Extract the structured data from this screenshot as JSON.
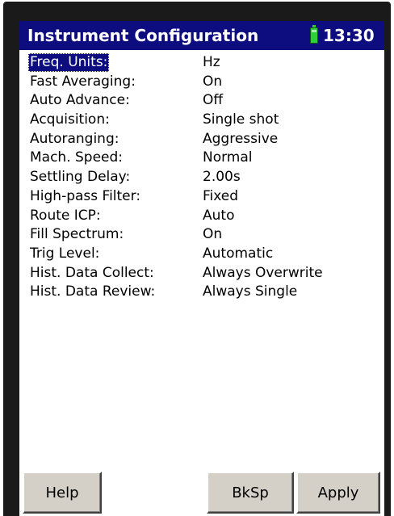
{
  "titlebar": {
    "title": "Instrument Configuration",
    "battery_icon": "battery-icon",
    "time": "13:30"
  },
  "settings": [
    {
      "label": "Freq. Units:",
      "value": "Hz",
      "selected": true
    },
    {
      "label": "Fast Averaging:",
      "value": "On"
    },
    {
      "label": "Auto Advance:",
      "value": "Off"
    },
    {
      "label": "Acquisition:",
      "value": "Single shot"
    },
    {
      "label": "Autoranging:",
      "value": "Aggressive"
    },
    {
      "label": "Mach. Speed:",
      "value": "Normal"
    },
    {
      "label": "Settling Delay:",
      "value": "2.00s"
    },
    {
      "label": "High-pass Filter:",
      "value": "Fixed"
    },
    {
      "label": "Route ICP:",
      "value": "Auto"
    },
    {
      "label": "Fill Spectrum:",
      "value": "On"
    },
    {
      "label": "Trig Level:",
      "value": "Automatic"
    },
    {
      "label": "Hist. Data Collect:",
      "value": "Always Overwrite"
    },
    {
      "label": "Hist. Data Review:",
      "value": "Always Single"
    }
  ],
  "buttons": {
    "help": "Help",
    "bksp": "BkSp",
    "apply": "Apply"
  },
  "colors": {
    "titlebar": "#0d0d80",
    "selection": "#0d0d80",
    "battery": "#2fcf3a",
    "bezel": "#1a1a1a",
    "button_face": "#d4d0c8"
  }
}
